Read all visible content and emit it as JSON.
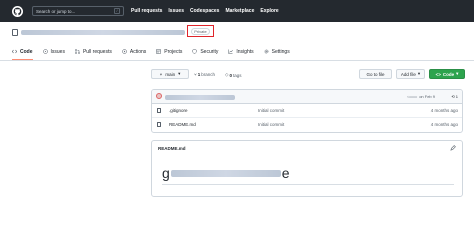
{
  "header": {
    "search_placeholder": "Search or jump to...",
    "search_shortcut": "/",
    "nav": [
      "Pull requests",
      "Issues",
      "Codespaces",
      "Marketplace",
      "Explore"
    ]
  },
  "repo": {
    "visibility_badge": "Private"
  },
  "tabs": [
    {
      "label": "Code",
      "icon": "code-icon"
    },
    {
      "label": "Issues",
      "icon": "issue-icon"
    },
    {
      "label": "Pull requests",
      "icon": "pull-request-icon"
    },
    {
      "label": "Actions",
      "icon": "play-icon"
    },
    {
      "label": "Projects",
      "icon": "table-icon"
    },
    {
      "label": "Security",
      "icon": "shield-icon"
    },
    {
      "label": "Insights",
      "icon": "graph-icon"
    },
    {
      "label": "Settings",
      "icon": "gear-icon"
    }
  ],
  "branch": {
    "selector_label": "main",
    "branches_count": "1",
    "branches_label": "branch",
    "tags_count": "0",
    "tags_label": "tags"
  },
  "actions": {
    "go_to_file": "Go to file",
    "add_file": "Add file",
    "code": "Code"
  },
  "commit": {
    "info": "on Feb 9",
    "history": "1"
  },
  "files": [
    {
      "name": ".gitignore",
      "message": "Initial commit",
      "time": "4 months ago"
    },
    {
      "name": "README.md",
      "message": "Initial commit",
      "time": "4 months ago"
    }
  ],
  "readme": {
    "title": "README.md",
    "heading_start": "g",
    "heading_end": "e"
  },
  "colors": {
    "header_bg": "#24292f",
    "active_tab_underline": "#fd8c73",
    "code_button": "#2da44e",
    "badge_highlight": "#e0242a"
  }
}
